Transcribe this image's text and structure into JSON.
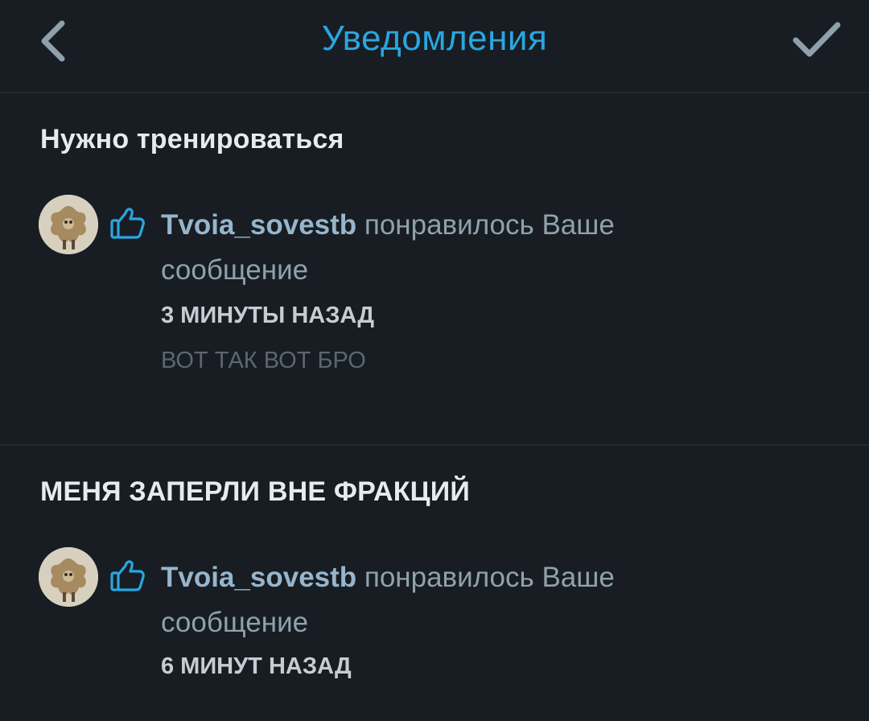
{
  "header": {
    "title": "Уведомления",
    "back_icon": "chevron-left-icon",
    "confirm_icon": "check-icon",
    "accent_color": "#2aa6e0"
  },
  "groups": [
    {
      "title": "Нужно тренироваться",
      "notifications": [
        {
          "icon": "thumbs-up-icon",
          "user": "Tvoia_sovestb",
          "action": " понравилось Ваше сообщение",
          "time": "3 МИНУТЫ НАЗАД",
          "excerpt": "ВОТ ТАК ВОТ БРО"
        }
      ]
    },
    {
      "title": "МЕНЯ ЗАПЕРЛИ ВНЕ ФРАКЦИЙ",
      "notifications": [
        {
          "icon": "thumbs-up-icon",
          "user": "Tvoia_sovestb",
          "action": " понравилось Ваше сообщение",
          "time": "6 МИНУТ НАЗАД"
        }
      ]
    }
  ]
}
